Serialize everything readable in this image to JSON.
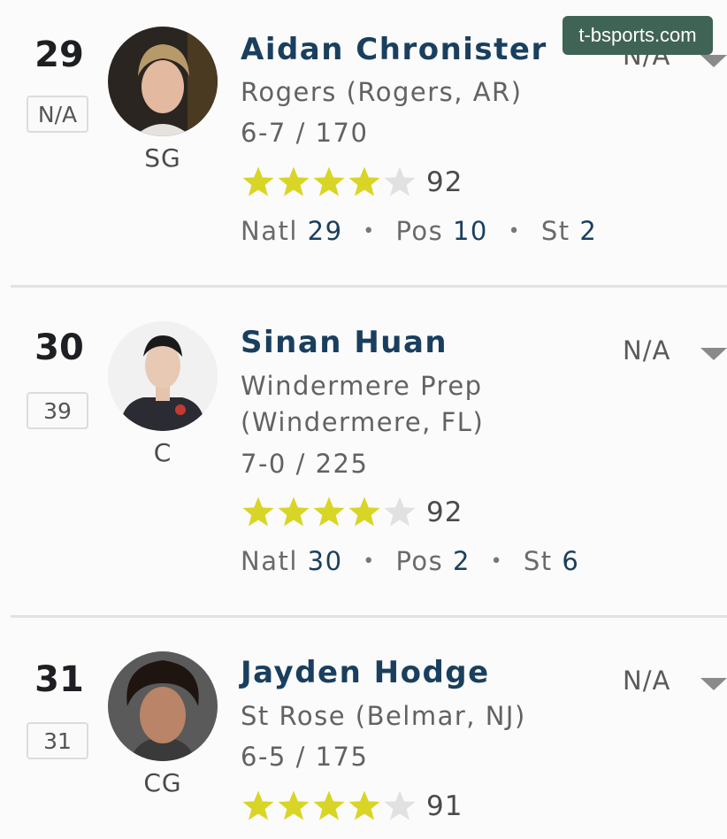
{
  "watermark": "t-bsports.com",
  "colors": {
    "star_on": "#d8d526",
    "star_off": "#e1e1e1",
    "name": "#1a3f5e",
    "divider": "#e2e2e2"
  },
  "players": [
    {
      "rank": "29",
      "prev_rank": "N/A",
      "position": "SG",
      "name": "Aidan Chronister",
      "school_lines": [
        "Rogers (Rogers, AR)"
      ],
      "height_weight": "6-7 / 170",
      "stars": 4,
      "score": "92",
      "natl_label": "Natl",
      "natl": "29",
      "pos_label": "Pos",
      "pos": "10",
      "st_label": "St",
      "st": "2",
      "status": "N/A"
    },
    {
      "rank": "30",
      "prev_rank": "39",
      "position": "C",
      "name": "Sinan Huan",
      "school_lines": [
        "Windermere Prep",
        "(Windermere, FL)"
      ],
      "height_weight": "7-0 / 225",
      "stars": 4,
      "score": "92",
      "natl_label": "Natl",
      "natl": "30",
      "pos_label": "Pos",
      "pos": "2",
      "st_label": "St",
      "st": "6",
      "status": "N/A"
    },
    {
      "rank": "31",
      "prev_rank": "31",
      "position": "CG",
      "name": "Jayden Hodge",
      "school_lines": [
        "St Rose (Belmar, NJ)"
      ],
      "height_weight": "6-5 / 175",
      "stars": 4,
      "score": "91",
      "status": "N/A"
    }
  ]
}
